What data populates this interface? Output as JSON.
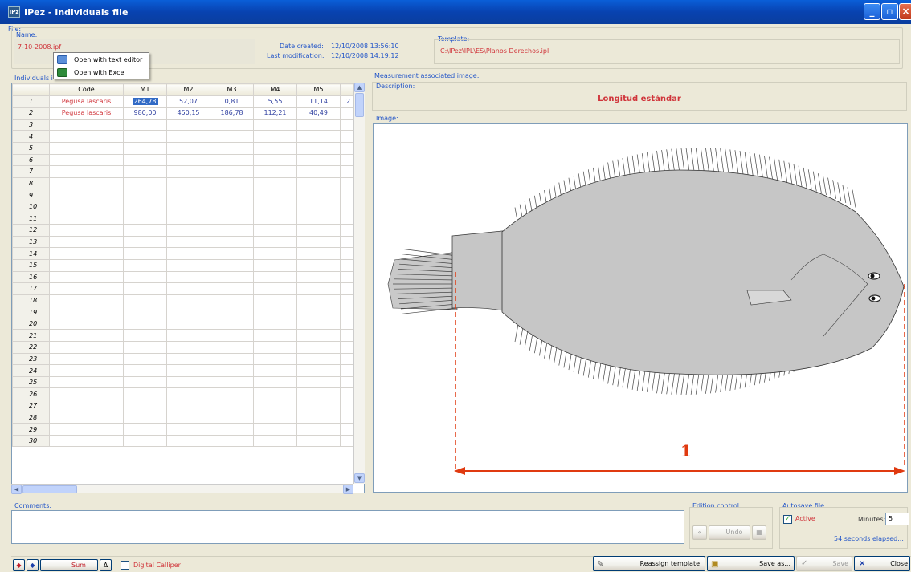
{
  "window": {
    "title": "IPez - Individuals file",
    "app_icon": "ipez-icon"
  },
  "file": {
    "group_label": "File:",
    "name_label": "Name:",
    "name_value": "7-10-2008.ipf",
    "date_created_label": "Date created:",
    "date_created_value": "12/10/2008 13:56:10",
    "last_mod_label": "Last modification:",
    "last_mod_value": "12/10/2008 14:19:12",
    "template_label": "Template:",
    "template_value": "C:\\IPez\\IPL\\ES\\Planos Derechos.ipl"
  },
  "context_menu": {
    "items": [
      {
        "label": "Open with text editor",
        "icon": "notepad-icon"
      },
      {
        "label": "Open with Excel",
        "icon": "excel-icon"
      }
    ]
  },
  "individuals": {
    "group_label": "Individuals i",
    "columns": [
      "Code",
      "M1",
      "M2",
      "M3",
      "M4",
      "M5"
    ],
    "rows": [
      {
        "n": "1",
        "code": "Pegusa lascaris",
        "m": [
          "264,78",
          "52,07",
          "0,81",
          "5,55",
          "11,14"
        ],
        "extra": "2"
      },
      {
        "n": "2",
        "code": "Pegusa lascaris",
        "m": [
          "980,00",
          "450,15",
          "186,78",
          "112,21",
          "40,49"
        ],
        "extra": ""
      }
    ],
    "empty_rows": [
      "3",
      "4",
      "5",
      "6",
      "7",
      "8",
      "9",
      "10",
      "11",
      "12",
      "13",
      "14",
      "15",
      "16",
      "17",
      "18",
      "19",
      "20",
      "21",
      "22",
      "23",
      "24",
      "25",
      "26",
      "27",
      "28",
      "29",
      "30"
    ]
  },
  "measurement": {
    "group_label": "Measurement associated image:",
    "description_label": "Description:",
    "description_value": "Longitud estándar",
    "image_label": "Image:",
    "measure_number": "1",
    "measure_color": "#E03A10"
  },
  "comments": {
    "label": "Comments:"
  },
  "edition": {
    "label": "Edition control:",
    "undo_label": "Undo"
  },
  "autosave": {
    "label": "Autosave file:",
    "active_label": "Active",
    "active_checked": true,
    "minutes_label": "Minutes:",
    "minutes_value": "5",
    "elapsed": "54 seconds elapsed..."
  },
  "toolbar": {
    "sum_label": "Sum",
    "digital_calliper_label": "Digital Calliper",
    "reassign_label": "Reassign template",
    "save_as_label": "Save as...",
    "save_label": "Save",
    "close_label": "Close"
  },
  "colors": {
    "titlebar": "#0A5FD8",
    "accent_red": "#D0343A",
    "label_blue": "#2154C8",
    "selection": "#316AC5"
  }
}
